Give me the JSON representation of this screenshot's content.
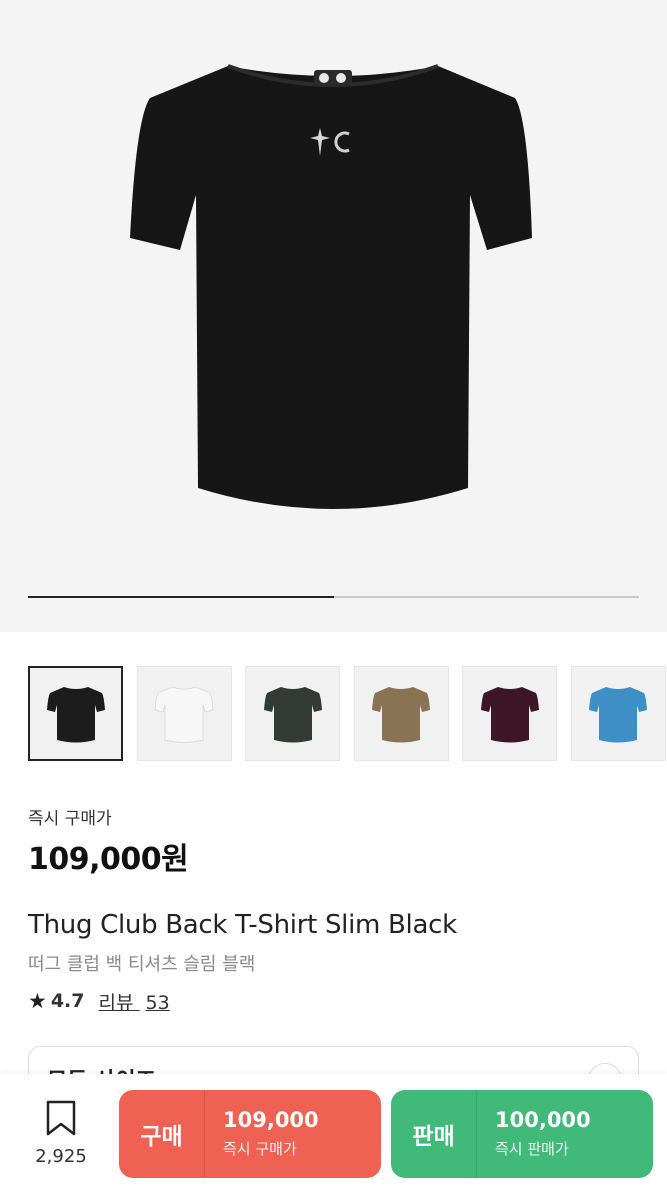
{
  "gallery": {
    "progress": 0.5,
    "thumbnails": [
      {
        "color": "#1c1c1c",
        "selected": true
      },
      {
        "color": "#f7f7f7",
        "selected": false
      },
      {
        "color": "#343a35",
        "selected": false
      },
      {
        "color": "#8a7355",
        "selected": false
      },
      {
        "color": "#3e1726",
        "selected": false
      },
      {
        "color": "#3d8fc6",
        "selected": false
      }
    ]
  },
  "price": {
    "label": "즉시 구매가",
    "value": "109,000원"
  },
  "product": {
    "title_en": "Thug Club Back T-Shirt Slim Black",
    "title_ko": "떠그 클럽 백 티셔츠 슬림 블랙"
  },
  "rating": {
    "score": "4.7",
    "review_label": "리뷰",
    "review_count": "53"
  },
  "size_select": {
    "label": "모든 사이즈"
  },
  "bottom_bar": {
    "bookmark_count": "2,925",
    "buy": {
      "label": "구매",
      "price": "109,000",
      "sub": "즉시 구매가"
    },
    "sell": {
      "label": "판매",
      "price": "100,000",
      "sub": "즉시 판매가"
    }
  },
  "colors": {
    "buy": "#ef6253",
    "sell": "#41b979"
  }
}
